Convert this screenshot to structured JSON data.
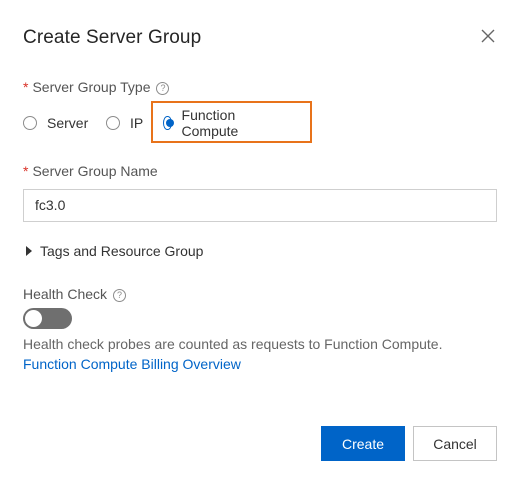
{
  "dialog": {
    "title": "Create Server Group"
  },
  "group_type": {
    "label": "Server Group Type",
    "required_mark": "*",
    "help": "?",
    "options": [
      {
        "label": "Server",
        "checked": false
      },
      {
        "label": "IP",
        "checked": false
      },
      {
        "label": "Function Compute",
        "checked": true
      }
    ]
  },
  "group_name": {
    "label": "Server Group Name",
    "required_mark": "*",
    "value": "fc3.0"
  },
  "tags": {
    "label": "Tags and Resource Group"
  },
  "health_check": {
    "label": "Health Check",
    "help": "?",
    "enabled": false,
    "description": "Health check probes are counted as requests to Function Compute. ",
    "link_text": "Function Compute Billing Overview"
  },
  "footer": {
    "create_label": "Create",
    "cancel_label": "Cancel"
  },
  "colors": {
    "accent": "#0064c8",
    "highlight": "#e8731a",
    "required": "#d93026"
  }
}
